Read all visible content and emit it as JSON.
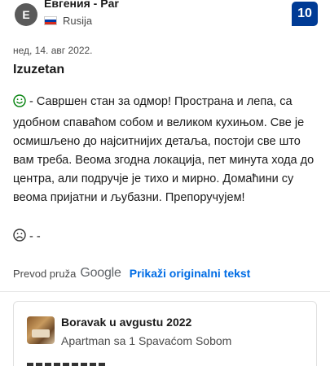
{
  "reviewer": {
    "initial": "E",
    "name": "Евгения - Par",
    "country": "Rusija",
    "flag_colors": [
      "#ffffff",
      "#0039a6",
      "#d52b1e"
    ]
  },
  "score": "10",
  "review": {
    "date": "нед, 14. авг 2022.",
    "title": "Izuzetan",
    "positive_text": " - Савршен стан за одмор! Пространа и лепа, са удобном спаваћом собом и великом кухињом. Све је осмишљено до најситнијих детаља, постоји све што вам треба. Веома згодна локација, пет минута хода до центра, али подручје је тихо и мирно. Домаћини су веома пријатни и љубазни. Препоручујем!",
    "negative_text": "- -",
    "positive_icon": "smile-face-icon",
    "negative_icon": "frown-face-icon"
  },
  "translation": {
    "provided_by": "Prevod pruža",
    "brand": "Google",
    "show_original": "Prikaži originalni tekst"
  },
  "stay": {
    "title": "Boravak u avgustu 2022",
    "room": "Apartman sa 1 Spavaćom Sobom"
  },
  "colors": {
    "score_bg": "#003b95",
    "link": "#006ce4",
    "positive_icon": "#008009"
  }
}
